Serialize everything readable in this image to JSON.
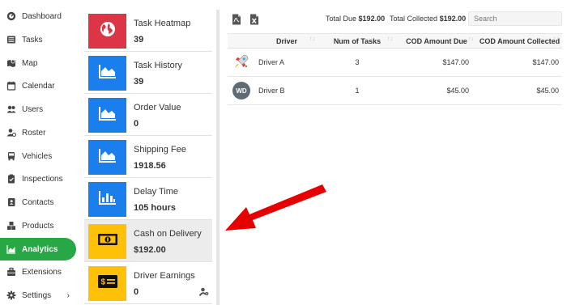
{
  "sidebar": {
    "items": [
      {
        "label": "Dashboard",
        "icon": "dashboard-icon"
      },
      {
        "label": "Tasks",
        "icon": "list-icon"
      },
      {
        "label": "Map",
        "icon": "map-icon"
      },
      {
        "label": "Calendar",
        "icon": "calendar-icon"
      },
      {
        "label": "Users",
        "icon": "users-icon"
      },
      {
        "label": "Roster",
        "icon": "roster-icon"
      },
      {
        "label": "Vehicles",
        "icon": "bus-icon"
      },
      {
        "label": "Inspections",
        "icon": "clipboard-check-icon"
      },
      {
        "label": "Contacts",
        "icon": "address-book-icon"
      },
      {
        "label": "Products",
        "icon": "boxes-icon"
      },
      {
        "label": "Analytics",
        "icon": "chart-area-icon",
        "active": true
      },
      {
        "label": "Extensions",
        "icon": "toolbox-icon"
      },
      {
        "label": "Settings",
        "icon": "gear-icon",
        "chevron": "›"
      }
    ]
  },
  "cards": [
    {
      "title": "Task Heatmap",
      "value": "39",
      "tile_color": "#dc3545",
      "icon": "globe-icon"
    },
    {
      "title": "Task History",
      "value": "39",
      "tile_color": "#1a7fec",
      "icon": "area-chart-icon"
    },
    {
      "title": "Order Value",
      "value": "0",
      "tile_color": "#1a7fec",
      "icon": "area-chart-icon"
    },
    {
      "title": "Shipping Fee",
      "value": "1918.56",
      "tile_color": "#1a7fec",
      "icon": "area-chart-icon"
    },
    {
      "title": "Delay Time",
      "value": "105 hours",
      "tile_color": "#1a7fec",
      "icon": "bar-chart-icon"
    },
    {
      "title": "Cash on Delivery",
      "value": "$192.00",
      "tile_color": "#ffc107",
      "icon": "money-bill-icon",
      "active": true
    },
    {
      "title": "Driver Earnings",
      "value": "0",
      "tile_color": "#ffc107",
      "icon": "money-check-icon",
      "settings_icon": "user-cog-icon"
    }
  ],
  "toolbar": {
    "pdf_icon": "pdf-file-icon",
    "excel_icon": "excel-file-icon",
    "total_due_label": "Total Due",
    "total_due_value": "$192.00",
    "total_collected_label": "Total Collected",
    "total_collected_value": "$192.00",
    "search_placeholder": "Search"
  },
  "table": {
    "headers": [
      "Driver",
      "Num of Tasks",
      "COD Amount Due",
      "COD Amount Collected"
    ],
    "rows": [
      {
        "avatar": "rocket-icon",
        "driver": "Driver A",
        "tasks": "3",
        "due": "$147.00",
        "collected": "$147.00"
      },
      {
        "avatar": "WD",
        "driver": "Driver B",
        "tasks": "1",
        "due": "$45.00",
        "collected": "$45.00"
      }
    ]
  },
  "colors": {
    "active_green": "#28a745",
    "red_tile": "#dc3545",
    "blue_tile": "#1a7fec",
    "yellow_tile": "#ffc107",
    "annotation_arrow": "#e60000"
  }
}
